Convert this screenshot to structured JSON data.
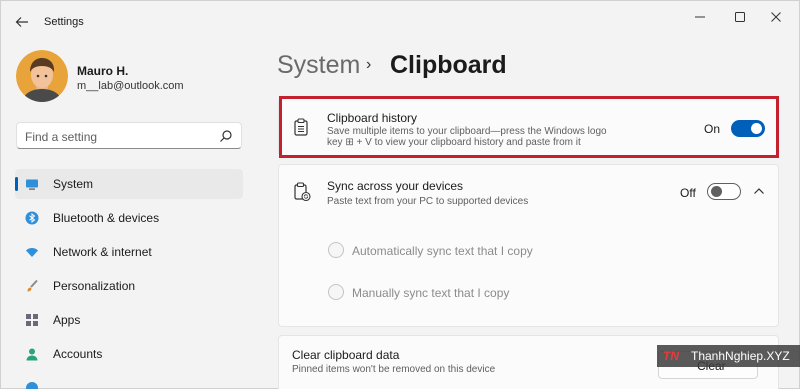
{
  "window": {
    "title": "Settings"
  },
  "profile": {
    "name": "Mauro H.",
    "email": "m__lab@outlook.com"
  },
  "search": {
    "placeholder": "Find a setting"
  },
  "sidebar": {
    "items": [
      {
        "label": "System",
        "icon": "monitor-icon",
        "active": true
      },
      {
        "label": "Bluetooth & devices",
        "icon": "bluetooth-icon",
        "active": false
      },
      {
        "label": "Network & internet",
        "icon": "wifi-icon",
        "active": false
      },
      {
        "label": "Personalization",
        "icon": "brush-icon",
        "active": false
      },
      {
        "label": "Apps",
        "icon": "apps-icon",
        "active": false
      },
      {
        "label": "Accounts",
        "icon": "person-icon",
        "active": false
      }
    ]
  },
  "header": {
    "breadcrumb_parent": "System",
    "separator": "›",
    "page_title": "Clipboard"
  },
  "settings": {
    "clipboard_history": {
      "title": "Clipboard history",
      "desc_line1": "Save multiple items to your clipboard—press the Windows logo",
      "desc_line2": "key ⊞ + V to view your clipboard history and paste from it",
      "state": "On"
    },
    "sync": {
      "title": "Sync across your devices",
      "desc": "Paste text from your PC to supported devices",
      "state": "Off",
      "options": [
        "Automatically sync text that I copy",
        "Manually sync text that I copy"
      ]
    },
    "clear": {
      "title": "Clear clipboard data",
      "desc": "Pinned items won't be removed on this device",
      "button": "Clear"
    }
  },
  "watermark": {
    "logo": "TN",
    "text": "ThanhNghiep.XYZ"
  },
  "colors": {
    "accent": "#005fb8",
    "highlight": "#c5202e",
    "background": "#f3f3f3"
  }
}
